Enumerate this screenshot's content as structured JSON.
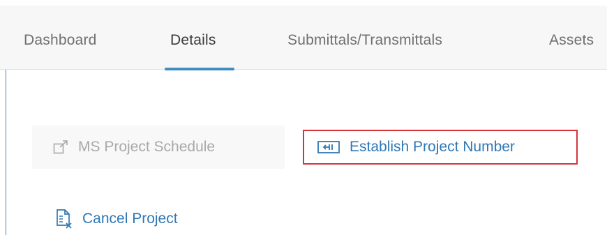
{
  "tabs": [
    {
      "label": "Dashboard",
      "active": false
    },
    {
      "label": "Details",
      "active": true
    },
    {
      "label": "Submittals/Transmittals",
      "active": false
    },
    {
      "label": "Assets",
      "active": false
    }
  ],
  "actions": {
    "ms_project_schedule": {
      "label": "MS Project Schedule",
      "icon": "external-link-icon",
      "enabled": false
    },
    "establish_project_number": {
      "label": "Establish Project Number",
      "icon": "enter-keyboard-icon",
      "highlighted": true
    },
    "cancel_project": {
      "label": "Cancel Project",
      "icon": "cancel-document-icon"
    }
  },
  "colors": {
    "accent": "#2f78b5",
    "tab_underline": "#3e8ebf",
    "highlight_border": "#d6333a",
    "disabled_text": "#a9a9a9",
    "tab_bar_bg": "#f7f7f7"
  }
}
